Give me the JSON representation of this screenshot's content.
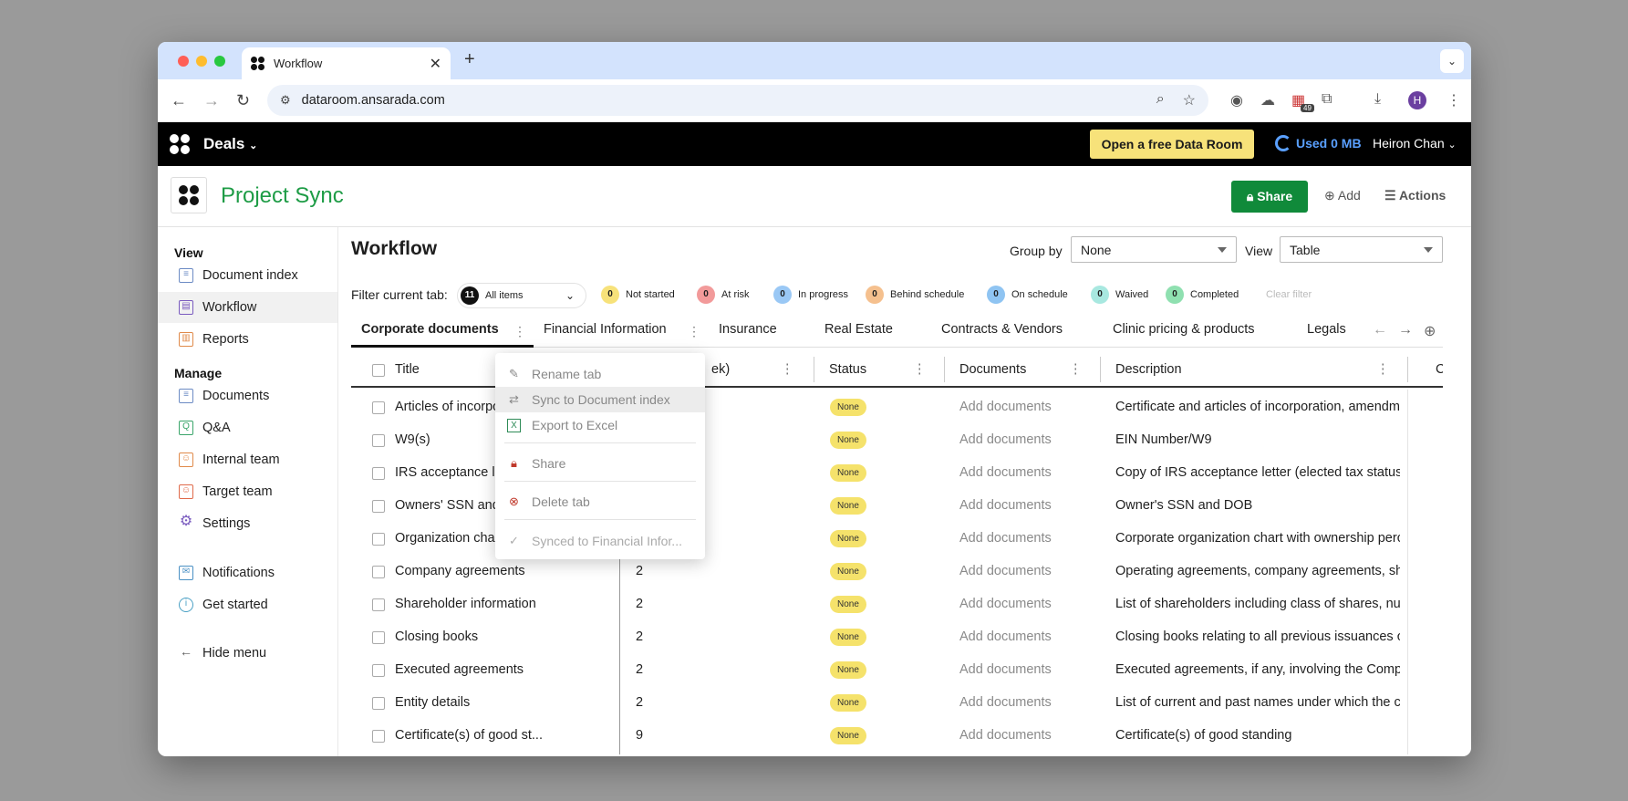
{
  "browser": {
    "tab_title": "Workflow",
    "url": "dataroom.ansarada.com",
    "extension_badge": "49",
    "profile_initial": "H"
  },
  "app": {
    "menu_label": "Deals",
    "free_button": "Open a free Data Room",
    "used": "Used 0 MB",
    "user_name": "Heiron Chan"
  },
  "project": {
    "title": "Project Sync",
    "share": "Share",
    "add": "Add",
    "actions": "Actions"
  },
  "sidebar": {
    "view_heading": "View",
    "view_items": [
      "Document index",
      "Workflow",
      "Reports"
    ],
    "manage_heading": "Manage",
    "manage_items": [
      "Documents",
      "Q&A",
      "Internal team",
      "Target team",
      "Settings"
    ],
    "other_items": [
      "Notifications",
      "Get started"
    ],
    "hide_menu": "Hide menu"
  },
  "workflow": {
    "title": "Workflow",
    "group_by_label": "Group by",
    "group_by_value": "None",
    "view_label": "View",
    "view_value": "Table",
    "filter_label": "Filter current tab:",
    "all_items_count": "11",
    "all_items_label": "All items",
    "statuses": [
      {
        "count": "0",
        "label": "Not started",
        "color": "#f7e27a"
      },
      {
        "count": "0",
        "label": "At risk",
        "color": "#f29a9a"
      },
      {
        "count": "0",
        "label": "In progress",
        "color": "#9ac8f5"
      },
      {
        "count": "0",
        "label": "Behind schedule",
        "color": "#f5c08e"
      },
      {
        "count": "0",
        "label": "On schedule",
        "color": "#8fc4f2"
      },
      {
        "count": "0",
        "label": "Waived",
        "color": "#a8e8e0"
      },
      {
        "count": "0",
        "label": "Completed",
        "color": "#8fe0b0"
      }
    ],
    "clear_filter": "Clear filter",
    "tabs": [
      "Corporate documents",
      "Financial Information",
      "Insurance",
      "Real Estate",
      "Contracts & Vendors",
      "Clinic pricing & products",
      "Legals"
    ],
    "columns": [
      "Title",
      "ek)",
      "Status",
      "Documents",
      "Description",
      "C"
    ],
    "rows": [
      {
        "title": "Articles of incorpo",
        "week": "",
        "status": "None",
        "documents": "Add documents",
        "description": "Certificate and articles of incorporation, amendm"
      },
      {
        "title": "W9(s)",
        "week": "",
        "status": "None",
        "documents": "Add documents",
        "description": "EIN Number/W9"
      },
      {
        "title": "IRS acceptance le",
        "week": "",
        "status": "None",
        "documents": "Add documents",
        "description": "Copy of IRS acceptance letter (elected tax status"
      },
      {
        "title": "Owners' SSN and",
        "week": "",
        "status": "None",
        "documents": "Add documents",
        "description": "Owner's SSN and DOB"
      },
      {
        "title": "Organization cha",
        "week": "",
        "status": "None",
        "documents": "Add documents",
        "description": "Corporate organization chart with ownership perc"
      },
      {
        "title": "Company agreements",
        "week": "2",
        "status": "None",
        "documents": "Add documents",
        "description": "Operating agreements, company agreements, sha"
      },
      {
        "title": "Shareholder information",
        "week": "2",
        "status": "None",
        "documents": "Add documents",
        "description": "List of shareholders including class of shares, nun"
      },
      {
        "title": "Closing books",
        "week": "2",
        "status": "None",
        "documents": "Add documents",
        "description": "Closing books relating to all previous issuances of"
      },
      {
        "title": "Executed agreements",
        "week": "2",
        "status": "None",
        "documents": "Add documents",
        "description": "Executed agreements, if any, involving the Compa"
      },
      {
        "title": "Entity details",
        "week": "2",
        "status": "None",
        "documents": "Add documents",
        "description": "List of current and past names under which the co"
      },
      {
        "title": "Certificate(s) of good st...",
        "week": "9",
        "status": "None",
        "documents": "Add documents",
        "description": "Certificate(s) of good standing"
      }
    ]
  },
  "context_menu": {
    "items": [
      "Rename tab",
      "Sync to Document index",
      "Export to Excel",
      "Share",
      "Delete tab",
      "Synced to Financial Infor..."
    ]
  }
}
